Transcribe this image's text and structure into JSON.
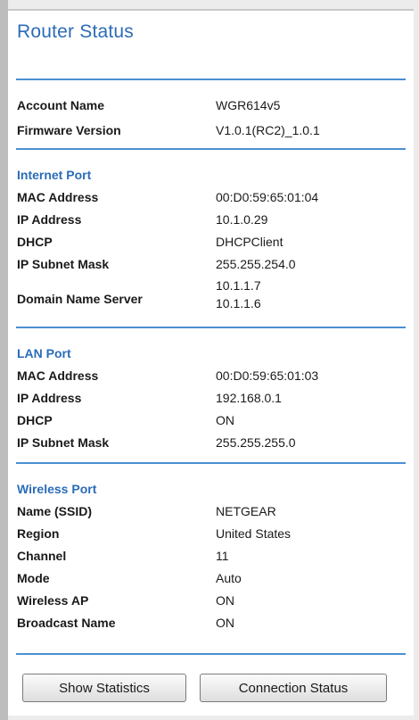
{
  "title": "Router Status",
  "account": [
    {
      "label": "Account Name",
      "value": "WGR614v5"
    },
    {
      "label": "Firmware Version",
      "value": "V1.0.1(RC2)_1.0.1"
    }
  ],
  "internet": {
    "heading": "Internet Port",
    "rows": [
      {
        "label": "MAC Address",
        "value": "00:D0:59:65:01:04"
      },
      {
        "label": "IP Address",
        "value": "10.1.0.29"
      },
      {
        "label": "DHCP",
        "value": "DHCPClient"
      },
      {
        "label": "IP Subnet Mask",
        "value": "255.255.254.0"
      }
    ],
    "dns_label": "Domain Name Server",
    "dns_values": [
      "10.1.1.7",
      "10.1.1.6"
    ]
  },
  "lan": {
    "heading": "LAN Port",
    "rows": [
      {
        "label": "MAC Address",
        "value": "00:D0:59:65:01:03"
      },
      {
        "label": "IP Address",
        "value": "192.168.0.1"
      },
      {
        "label": "DHCP",
        "value": "ON"
      },
      {
        "label": "IP Subnet Mask",
        "value": "255.255.255.0"
      }
    ]
  },
  "wireless": {
    "heading": "Wireless Port",
    "rows": [
      {
        "label": "Name (SSID)",
        "value": "NETGEAR"
      },
      {
        "label": "Region",
        "value": "United States"
      },
      {
        "label": "Channel",
        "value": "11"
      },
      {
        "label": "Mode",
        "value": "Auto"
      },
      {
        "label": "Wireless AP",
        "value": "ON"
      },
      {
        "label": "Broadcast Name",
        "value": "ON"
      }
    ]
  },
  "buttons": {
    "show_statistics": "Show Statistics",
    "connection_status": "Connection Status"
  },
  "colors": {
    "accent": "#2b6cb8",
    "rule": "#4a90d0"
  }
}
